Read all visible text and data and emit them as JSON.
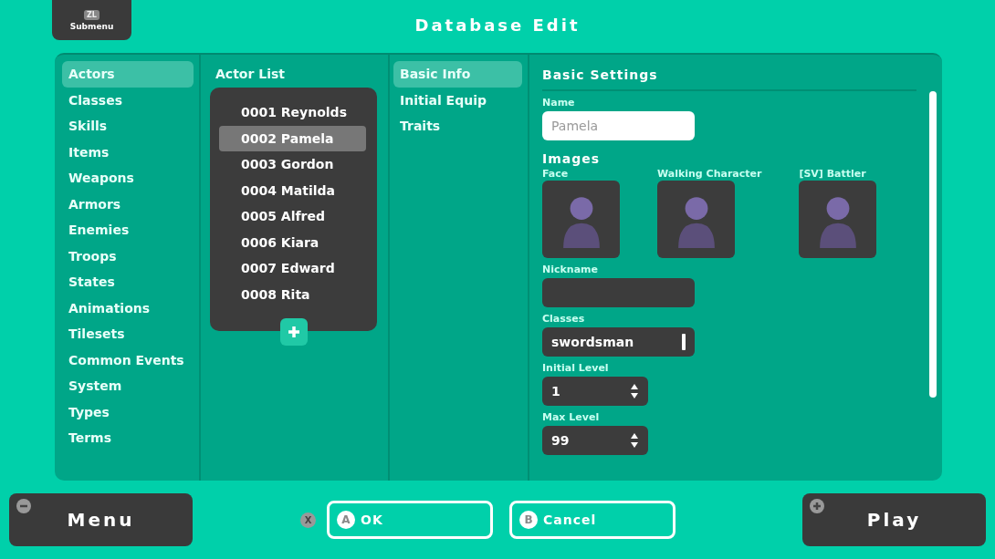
{
  "window": {
    "title": "Database Edit"
  },
  "submenu": {
    "key": "ZL",
    "label": "Submenu"
  },
  "categories": [
    {
      "label": "Actors",
      "selected": true
    },
    {
      "label": "Classes",
      "selected": false
    },
    {
      "label": "Skills",
      "selected": false
    },
    {
      "label": "Items",
      "selected": false
    },
    {
      "label": "Weapons",
      "selected": false
    },
    {
      "label": "Armors",
      "selected": false
    },
    {
      "label": "Enemies",
      "selected": false
    },
    {
      "label": "Troops",
      "selected": false
    },
    {
      "label": "States",
      "selected": false
    },
    {
      "label": "Animations",
      "selected": false
    },
    {
      "label": "Tilesets",
      "selected": false
    },
    {
      "label": "Common Events",
      "selected": false
    },
    {
      "label": "System",
      "selected": false
    },
    {
      "label": "Types",
      "selected": false
    },
    {
      "label": "Terms",
      "selected": false
    }
  ],
  "actor_list": {
    "title": "Actor List",
    "items": [
      {
        "label": "0001 Reynolds",
        "selected": false
      },
      {
        "label": "0002 Pamela",
        "selected": true
      },
      {
        "label": "0003 Gordon",
        "selected": false
      },
      {
        "label": "0004 Matilda",
        "selected": false
      },
      {
        "label": "0005 Alfred",
        "selected": false
      },
      {
        "label": "0006 Kiara",
        "selected": false
      },
      {
        "label": "0007 Edward",
        "selected": false
      },
      {
        "label": "0008 Rita",
        "selected": false
      }
    ]
  },
  "tabs": [
    {
      "label": "Basic Info",
      "selected": true
    },
    {
      "label": "Initial Equip",
      "selected": false
    },
    {
      "label": "Traits",
      "selected": false
    }
  ],
  "basic_settings": {
    "title": "Basic Settings",
    "name": {
      "label": "Name",
      "value": "Pamela"
    },
    "images": {
      "title": "Images",
      "slots": [
        {
          "label": "Face"
        },
        {
          "label": "Walking Character"
        },
        {
          "label": "[SV] Battler"
        }
      ]
    },
    "nickname": {
      "label": "Nickname"
    },
    "classes": {
      "label": "Classes",
      "value": "swordsman"
    },
    "initial_level": {
      "label": "Initial Level",
      "value": "1"
    },
    "max_level": {
      "label": "Max Level",
      "value": "99"
    }
  },
  "footer": {
    "menu": {
      "label": "Menu"
    },
    "cancel_key": "X",
    "ok": {
      "key": "A",
      "label": "OK"
    },
    "cancel": {
      "key": "B",
      "label": "Cancel"
    },
    "play": {
      "label": "Play"
    }
  }
}
